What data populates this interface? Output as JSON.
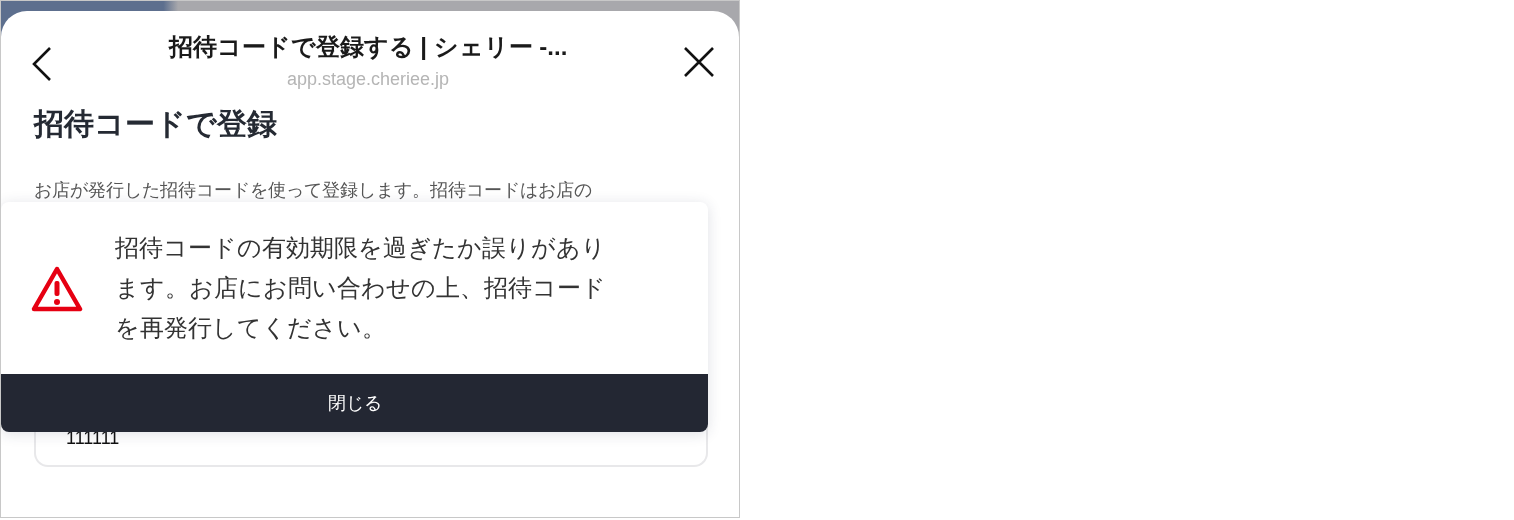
{
  "header": {
    "title": "招待コードで登録する | シェリー -...",
    "url": "app.stage.cheriee.jp"
  },
  "heading": "招待コードで登録",
  "description": "お店が発行した招待コードを使って登録します。招待コードはお店の",
  "code_field": {
    "value": "111111"
  },
  "dialog": {
    "message": "招待コードの有効期限を過ぎたか誤りがあります。お店にお問い合わせの上、招待コードを再発行してください。",
    "button": "閉じる"
  }
}
